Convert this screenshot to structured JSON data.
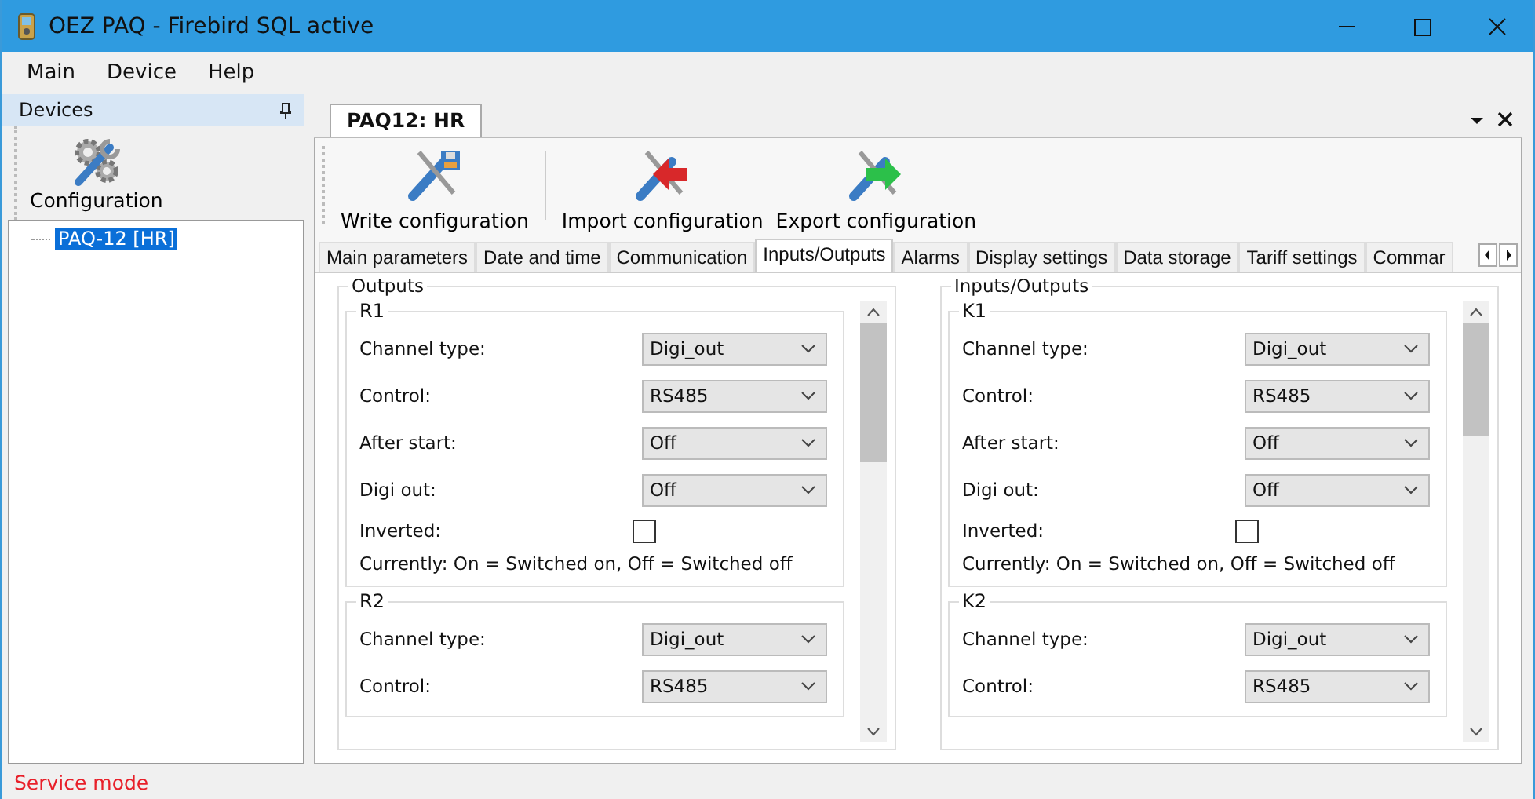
{
  "window": {
    "title": "OEZ PAQ - Firebird SQL active"
  },
  "menu": [
    "Main",
    "Device",
    "Help"
  ],
  "devices_panel": {
    "title": "Devices",
    "toolbar_button": "Configuration",
    "tree": [
      {
        "label": "PAQ-12 [HR]",
        "selected": true
      }
    ]
  },
  "document_tab": {
    "label": "PAQ12: HR"
  },
  "toolbar": [
    {
      "kind": "write",
      "label": "Write configuration"
    },
    {
      "kind": "import",
      "label": "Import configuration"
    },
    {
      "kind": "export",
      "label": "Export configuration"
    }
  ],
  "tabs": [
    {
      "label": "Main parameters",
      "selected": false
    },
    {
      "label": "Date and time",
      "selected": false
    },
    {
      "label": "Communication",
      "selected": false
    },
    {
      "label": "Inputs/Outputs",
      "selected": true
    },
    {
      "label": "Alarms",
      "selected": false
    },
    {
      "label": "Display settings",
      "selected": false
    },
    {
      "label": "Data storage",
      "selected": false
    },
    {
      "label": "Tariff settings",
      "selected": false
    },
    {
      "label": "Commar",
      "selected": false
    }
  ],
  "panels": [
    {
      "title": "Outputs",
      "channels": [
        {
          "name": "R1",
          "fields": [
            {
              "kind": "select",
              "label": "Channel type:",
              "value": "Digi_out"
            },
            {
              "kind": "select",
              "label": "Control:",
              "value": "RS485"
            },
            {
              "kind": "select",
              "label": "After start:",
              "value": "Off"
            },
            {
              "kind": "select",
              "label": "Digi out:",
              "value": "Off"
            },
            {
              "kind": "checkbox",
              "label": "Inverted:",
              "checked": false
            },
            {
              "kind": "note",
              "text": "Currently: On = Switched on, Off = Switched off"
            }
          ]
        },
        {
          "name": "R2",
          "fields": [
            {
              "kind": "select",
              "label": "Channel type:",
              "value": "Digi_out"
            },
            {
              "kind": "select",
              "label": "Control:",
              "value": "RS485"
            }
          ]
        }
      ]
    },
    {
      "title": "Inputs/Outputs",
      "channels": [
        {
          "name": "K1",
          "fields": [
            {
              "kind": "select",
              "label": "Channel type:",
              "value": "Digi_out"
            },
            {
              "kind": "select",
              "label": "Control:",
              "value": "RS485"
            },
            {
              "kind": "select",
              "label": "After start:",
              "value": "Off"
            },
            {
              "kind": "select",
              "label": "Digi out:",
              "value": "Off"
            },
            {
              "kind": "checkbox",
              "label": "Inverted:",
              "checked": false
            },
            {
              "kind": "note",
              "text": "Currently: On = Switched on, Off = Switched off"
            }
          ]
        },
        {
          "name": "K2",
          "fields": [
            {
              "kind": "select",
              "label": "Channel type:",
              "value": "Digi_out"
            },
            {
              "kind": "select",
              "label": "Control:",
              "value": "RS485"
            }
          ]
        }
      ]
    }
  ],
  "status_bar": {
    "text": "Service mode"
  }
}
